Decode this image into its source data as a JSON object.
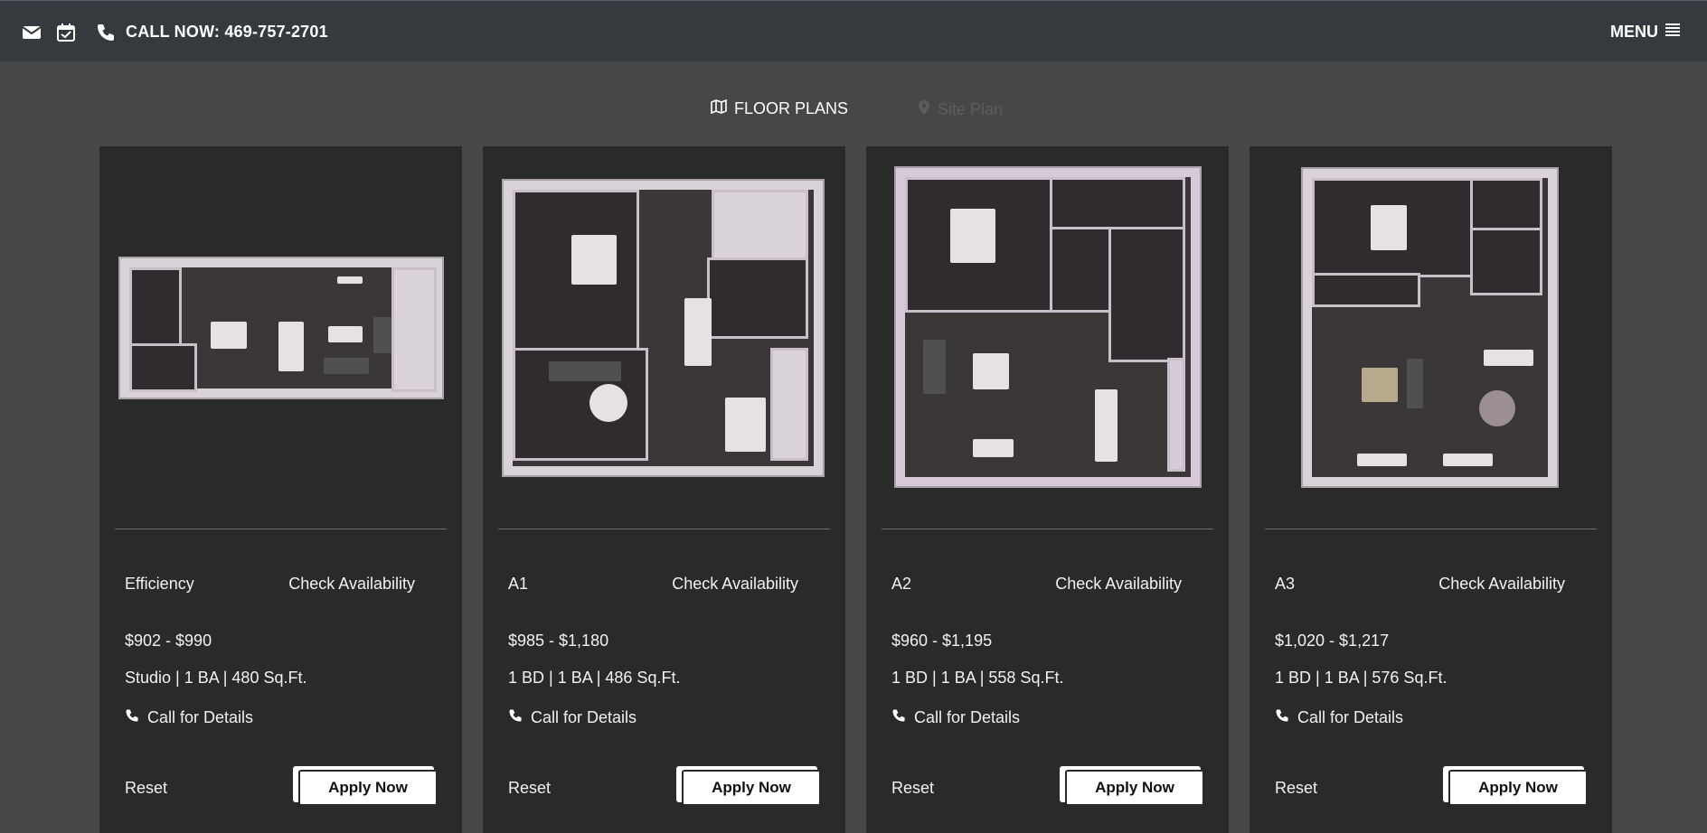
{
  "header": {
    "call_label": "CALL NOW: 469-757-2701",
    "menu_label": "MENU",
    "icons": [
      "envelope-icon",
      "calendar-check-icon",
      "phone-icon",
      "hamburger-icon"
    ]
  },
  "tabs": [
    {
      "label": "FLOOR PLANS",
      "icon": "map-icon",
      "active": true
    },
    {
      "label": "Site Plan",
      "icon": "map-pin-icon",
      "active": false
    }
  ],
  "cards": [
    {
      "name": "Efficiency",
      "check_label": "Check Availability",
      "price": "$902 - $990",
      "specs": "Studio | 1 BA | 480 Sq.Ft.",
      "call_label": "Call for Details",
      "reset_label": "Reset",
      "apply_label": "Apply Now"
    },
    {
      "name": "A1",
      "check_label": "Check Availability",
      "price": "$985 - $1,180",
      "specs": "1 BD | 1 BA | 486 Sq.Ft.",
      "call_label": "Call for Details",
      "reset_label": "Reset",
      "apply_label": "Apply Now"
    },
    {
      "name": "A2",
      "check_label": "Check Availability",
      "price": "$960 - $1,195",
      "specs": "1 BD | 1 BA | 558 Sq.Ft.",
      "call_label": "Call for Details",
      "reset_label": "Reset",
      "apply_label": "Apply Now"
    },
    {
      "name": "A3",
      "check_label": "Check Availability",
      "price": "$1,020 - $1,217",
      "specs": "1 BD | 1 BA | 576 Sq.Ft.",
      "call_label": "Call for Details",
      "reset_label": "Reset",
      "apply_label": "Apply Now"
    }
  ],
  "colors": {
    "page_bg": "#474747",
    "header_bg": "#353a3e",
    "card_bg": "#2a2a2a",
    "button_bg": "#ffffff",
    "inactive_tab": "#5d5d5d"
  }
}
